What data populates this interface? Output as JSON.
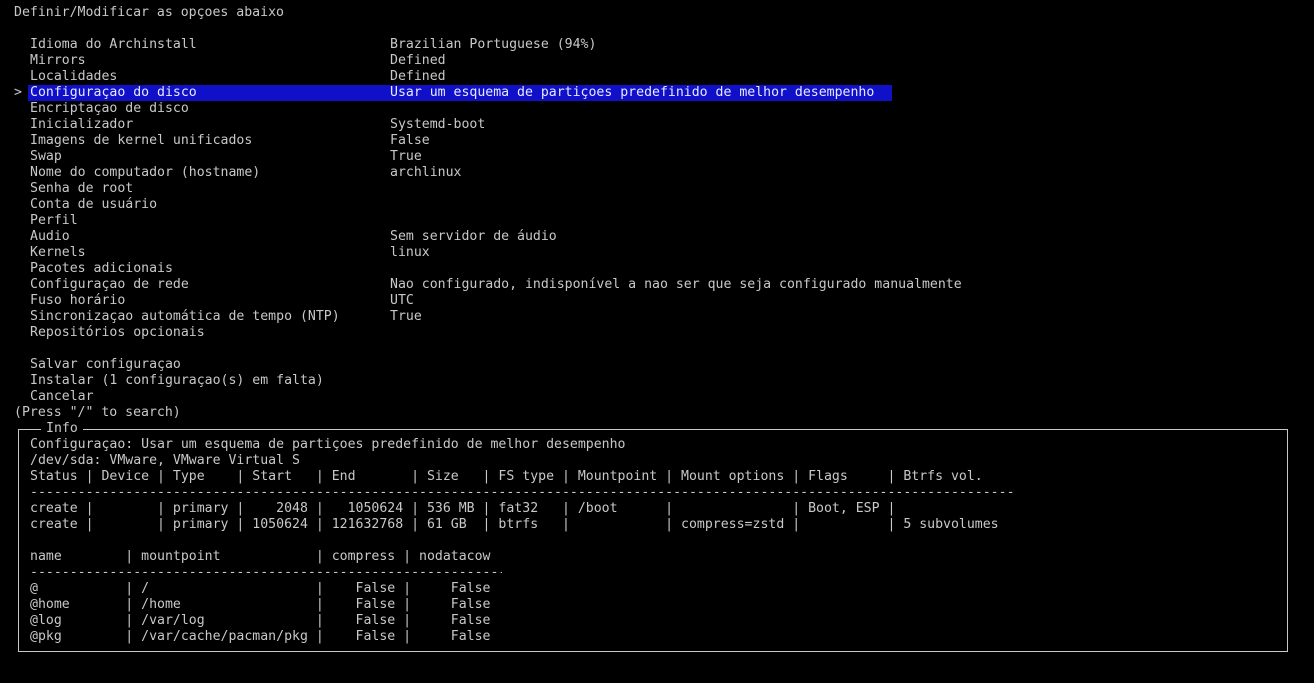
{
  "header": {
    "title": "Definir/Modificar as opçoes abaixo"
  },
  "menu": {
    "cursor": ">",
    "items": [
      {
        "label": "Idioma do Archinstall",
        "value": "Brazilian Portuguese (94%)"
      },
      {
        "label": "Mirrors",
        "value": "Defined"
      },
      {
        "label": "Localidades",
        "value": "Defined"
      },
      {
        "label": "Configuraçao do disco",
        "value": "Usar um esquema de partiçoes predefinido de melhor desempenho"
      },
      {
        "label": "Encriptaçao de disco",
        "value": ""
      },
      {
        "label": "Inicializador",
        "value": "Systemd-boot"
      },
      {
        "label": "Imagens de kernel unificados",
        "value": "False"
      },
      {
        "label": "Swap",
        "value": "True"
      },
      {
        "label": "Nome do computador (hostname)",
        "value": "archlinux"
      },
      {
        "label": "Senha de root",
        "value": ""
      },
      {
        "label": "Conta de usuário",
        "value": ""
      },
      {
        "label": "Perfil",
        "value": ""
      },
      {
        "label": "Audio",
        "value": "Sem servidor de áudio"
      },
      {
        "label": "Kernels",
        "value": "linux"
      },
      {
        "label": "Pacotes adicionais",
        "value": ""
      },
      {
        "label": "Configuraçao de rede",
        "value": "Nao configurado, indisponível a nao ser que seja configurado manualmente"
      },
      {
        "label": "Fuso horário",
        "value": "UTC"
      },
      {
        "label": "Sincronizaçao automática de tempo (NTP)",
        "value": "True"
      },
      {
        "label": "Repositórios opcionais",
        "value": ""
      }
    ],
    "actions": [
      {
        "label": "Salvar configuraçao"
      },
      {
        "label": "Instalar (1 configuraçao(s) em falta)"
      },
      {
        "label": "Cancelar"
      }
    ],
    "search_hint": "(Press \"/\" to search)"
  },
  "info": {
    "title": "Info",
    "config_line": "Configuraçao: Usar um esquema de partiçoes predefinido de melhor desempenho",
    "device_line": "/dev/sda: VMware, VMware Virtual S",
    "partition_header": "Status | Device | Type    | Start   | End       | Size   | FS type | Mountpoint | Mount options | Flags     | Btrfs vol.",
    "partition_separator": "------------------------------------------------------------------------------------------------------------------------------------",
    "partition_rows": [
      "create |        | primary |    2048 |   1050624 | 536 MB | fat32   | /boot      |               | Boot, ESP |",
      "create |        | primary | 1050624 | 121632768 | 61 GB  | btrfs   |            | compress=zstd |           | 5 subvolumes"
    ],
    "subvol_header": "name        | mountpoint            | compress | nodatacow",
    "subvol_separator": "-------------------------------------------------------------",
    "subvol_rows": [
      "@           | /                     |    False |     False",
      "@home       | /home                 |    False |     False",
      "@log        | /var/log              |    False |     False",
      "@pkg        | /var/cache/pacman/pkg |    False |     False"
    ]
  },
  "colors": {
    "background": "#000000",
    "foreground": "#c8c8c8",
    "selection": "#1010c8"
  }
}
